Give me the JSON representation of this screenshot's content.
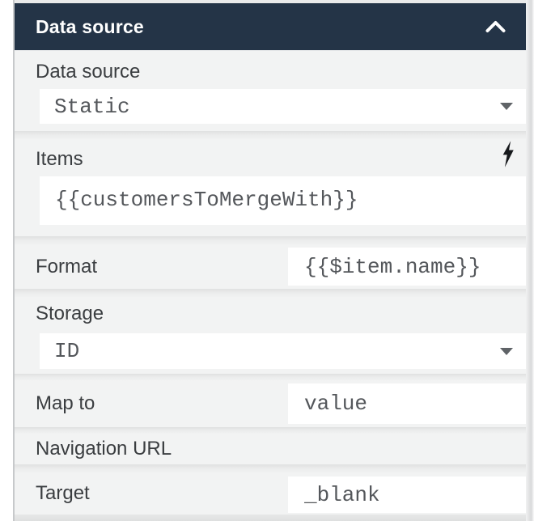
{
  "header": {
    "title": "Data source"
  },
  "fields": {
    "data_source": {
      "label": "Data source",
      "value": "Static",
      "control": "dropdown"
    },
    "items": {
      "label": "Items",
      "value": "{{customersToMergeWith}}",
      "control": "code"
    },
    "format": {
      "label": "Format",
      "value": "{{$item.name}}",
      "control": "text"
    },
    "storage": {
      "label": "Storage",
      "value": "ID",
      "control": "dropdown"
    },
    "map_to": {
      "label": "Map to",
      "value": "value",
      "control": "text"
    },
    "navigation_url": {
      "label": "Navigation URL",
      "value": "",
      "control": "label-only"
    },
    "target": {
      "label": "Target",
      "value": "_blank",
      "control": "text"
    }
  },
  "icons": {
    "header_collapse": "chevron-up-icon",
    "items_binding": "lightning-bolt-icon",
    "dropdown": "caret-down-icon"
  },
  "colors": {
    "header_bg": "#243447",
    "header_text": "#ffffff",
    "section_bg": "#f2f3f3",
    "field_bg": "#ffffff",
    "label_text": "#3a3d40",
    "value_text": "#54575b",
    "separator": "#e2e3e3",
    "left_line": "#c7c9cb",
    "icon_dark": "#17191c"
  }
}
